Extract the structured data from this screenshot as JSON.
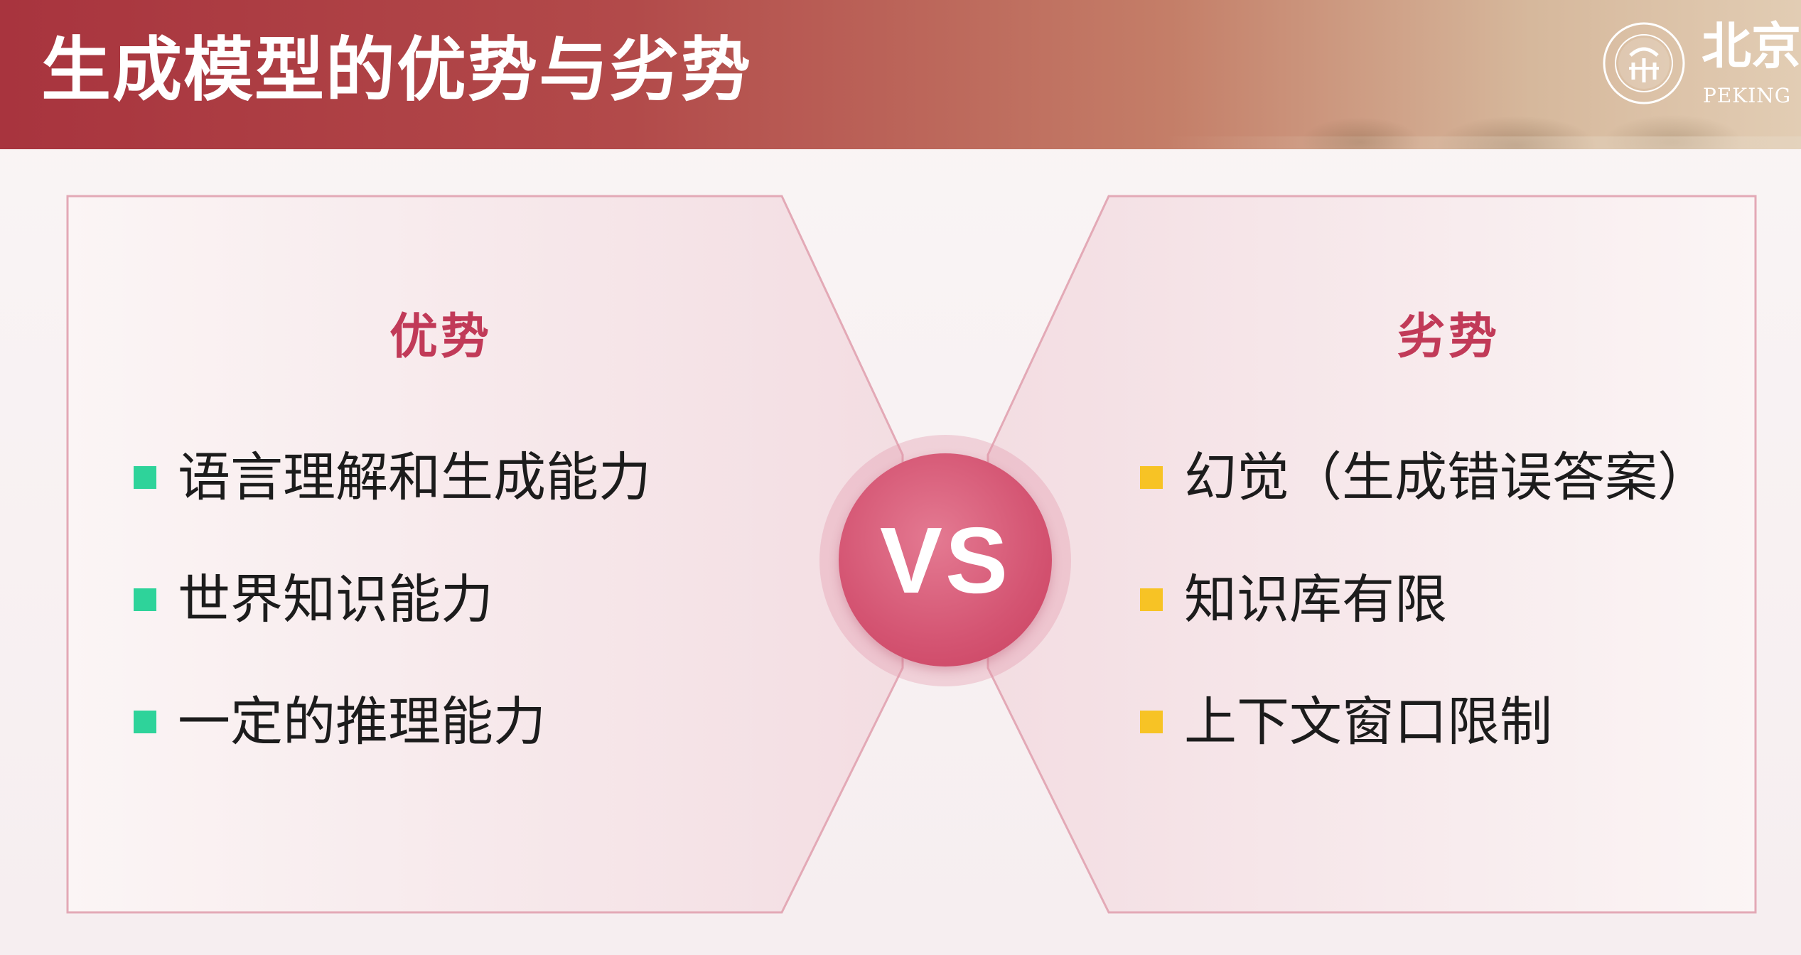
{
  "header": {
    "title": "生成模型的优势与劣势",
    "logo_cn": "北京",
    "logo_en": "PEKING"
  },
  "left": {
    "title": "优势",
    "items": [
      "语言理解和生成能力",
      "世界知识能力",
      "一定的推理能力"
    ]
  },
  "right": {
    "title": "劣势",
    "items": [
      "幻觉（生成错误答案）",
      "知识库有限",
      "上下文窗口限制"
    ]
  },
  "vs_label": "VS",
  "colors": {
    "header_red": "#a8343e",
    "accent_pink": "#c13a58",
    "bullet_green": "#2ed39a",
    "bullet_yellow": "#f7c325",
    "vs_circle": "#d45472"
  }
}
